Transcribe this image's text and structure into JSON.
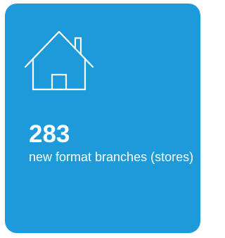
{
  "card": {
    "icon": "home-icon",
    "background_color": "#1c9ad9",
    "text_color": "#ffffff"
  },
  "stat": {
    "value": "283",
    "label": "new format branches (stores)"
  }
}
